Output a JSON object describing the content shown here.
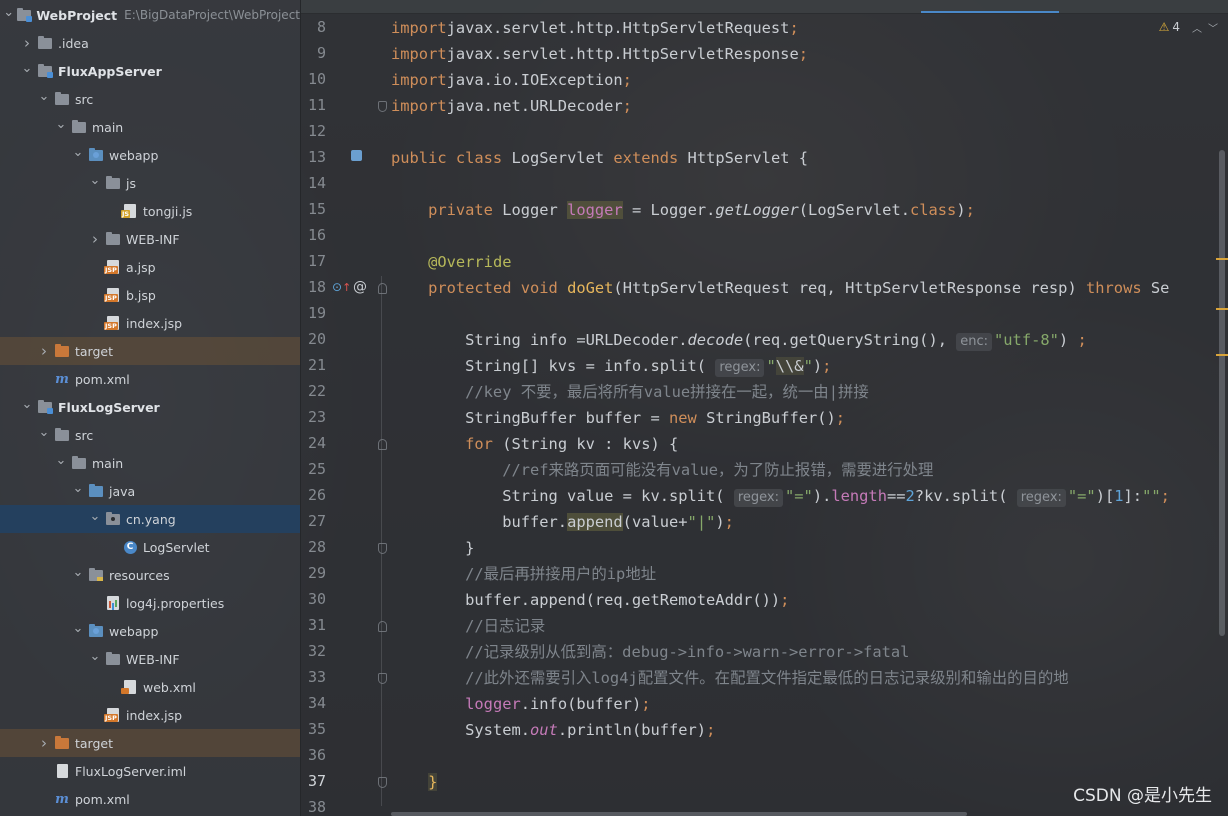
{
  "project_tree": {
    "rows": [
      {
        "label": "WebProject",
        "path": "E:\\BigDataProject\\WebProject",
        "icon": "module-folder-icon",
        "depth": 0,
        "arrow": "down",
        "bold": true
      },
      {
        "label": ".idea",
        "icon": "folder-icon",
        "depth": 1,
        "arrow": "right"
      },
      {
        "label": "FluxAppServer",
        "icon": "module-folder-icon",
        "depth": 1,
        "arrow": "down",
        "bold": true
      },
      {
        "label": "src",
        "icon": "folder-icon",
        "depth": 2,
        "arrow": "down"
      },
      {
        "label": "main",
        "icon": "folder-icon",
        "depth": 3,
        "arrow": "down"
      },
      {
        "label": "webapp",
        "icon": "web-folder-icon",
        "depth": 4,
        "arrow": "down"
      },
      {
        "label": "js",
        "icon": "folder-icon",
        "depth": 5,
        "arrow": "down"
      },
      {
        "label": "tongji.js",
        "icon": "js-file-icon",
        "depth": 6,
        "arrow": "none"
      },
      {
        "label": "WEB-INF",
        "icon": "folder-icon",
        "depth": 5,
        "arrow": "right"
      },
      {
        "label": "a.jsp",
        "icon": "jsp-file-icon",
        "depth": 5,
        "arrow": "none"
      },
      {
        "label": "b.jsp",
        "icon": "jsp-file-icon",
        "depth": 5,
        "arrow": "none"
      },
      {
        "label": "index.jsp",
        "icon": "jsp-file-icon",
        "depth": 5,
        "arrow": "none"
      },
      {
        "label": "target",
        "icon": "excluded-folder-icon",
        "depth": 2,
        "arrow": "right",
        "state": "excluded"
      },
      {
        "label": "pom.xml",
        "icon": "maven-icon",
        "depth": 2,
        "arrow": "none"
      },
      {
        "label": "FluxLogServer",
        "icon": "module-folder-icon",
        "depth": 1,
        "arrow": "down",
        "bold": true
      },
      {
        "label": "src",
        "icon": "folder-icon",
        "depth": 2,
        "arrow": "down"
      },
      {
        "label": "main",
        "icon": "folder-icon",
        "depth": 3,
        "arrow": "down"
      },
      {
        "label": "java",
        "icon": "source-folder-icon",
        "depth": 4,
        "arrow": "down"
      },
      {
        "label": "cn.yang",
        "icon": "package-icon",
        "depth": 5,
        "arrow": "down",
        "state": "selected"
      },
      {
        "label": "LogServlet",
        "icon": "class-icon",
        "depth": 6,
        "arrow": "none"
      },
      {
        "label": "resources",
        "icon": "resources-folder-icon",
        "depth": 4,
        "arrow": "down"
      },
      {
        "label": "log4j.properties",
        "icon": "properties-file-icon",
        "depth": 5,
        "arrow": "none"
      },
      {
        "label": "webapp",
        "icon": "web-folder-icon",
        "depth": 4,
        "arrow": "down"
      },
      {
        "label": "WEB-INF",
        "icon": "folder-icon",
        "depth": 5,
        "arrow": "down"
      },
      {
        "label": "web.xml",
        "icon": "xml-file-icon",
        "depth": 6,
        "arrow": "none"
      },
      {
        "label": "index.jsp",
        "icon": "jsp-file-icon",
        "depth": 5,
        "arrow": "none"
      },
      {
        "label": "target",
        "icon": "excluded-folder-icon",
        "depth": 2,
        "arrow": "right",
        "state": "excluded"
      },
      {
        "label": "FluxLogServer.iml",
        "icon": "iml-file-icon",
        "depth": 2,
        "arrow": "none"
      },
      {
        "label": "pom.xml",
        "icon": "maven-icon",
        "depth": 2,
        "arrow": "none"
      }
    ]
  },
  "editor": {
    "inspection_count": "4",
    "current_line": 37,
    "lines": [
      {
        "n": 8,
        "tokens": [
          [
            "kw",
            "import"
          ],
          [
            "",
            "javax.servlet.http.HttpServletRequest"
          ],
          [
            "kw",
            ";"
          ]
        ]
      },
      {
        "n": 9,
        "tokens": [
          [
            "kw",
            "import"
          ],
          [
            "",
            "javax.servlet.http.HttpServletResponse"
          ],
          [
            "kw",
            ";"
          ]
        ]
      },
      {
        "n": 10,
        "tokens": [
          [
            "kw",
            "import"
          ],
          [
            "",
            "java.io.IOException"
          ],
          [
            "kw",
            ";"
          ]
        ]
      },
      {
        "n": 11,
        "tokens": [
          [
            "kw",
            "import"
          ],
          [
            "",
            "java.net.URLDecoder"
          ],
          [
            "kw",
            ";"
          ]
        ]
      },
      {
        "n": 12,
        "tokens": []
      },
      {
        "n": 13,
        "tokens": [
          [
            "kw",
            "public class "
          ],
          [
            "",
            "LogServlet "
          ],
          [
            "kw",
            "extends "
          ],
          [
            "",
            "HttpServlet {"
          ]
        ]
      },
      {
        "n": 14,
        "tokens": []
      },
      {
        "n": 15,
        "tokens": [
          [
            "",
            "    "
          ],
          [
            "kw",
            "private "
          ],
          [
            "",
            "Logger "
          ],
          [
            "field hl",
            "logger"
          ],
          [
            "",
            " = Logger."
          ],
          [
            "it",
            "getLogger"
          ],
          [
            "",
            "(LogServlet."
          ],
          [
            "kw",
            "class"
          ],
          [
            "",
            ")"
          ],
          [
            "kw",
            ";"
          ]
        ]
      },
      {
        "n": 16,
        "tokens": []
      },
      {
        "n": 17,
        "tokens": [
          [
            "",
            "    "
          ],
          [
            "ann",
            "@Override"
          ]
        ]
      },
      {
        "n": 18,
        "tokens": [
          [
            "",
            "    "
          ],
          [
            "kw",
            "protected void "
          ],
          [
            "fn",
            "doGet"
          ],
          [
            "",
            "(HttpServletRequest req, HttpServletResponse resp) "
          ],
          [
            "kw",
            "throws "
          ],
          [
            "",
            "Se"
          ]
        ]
      },
      {
        "n": 19,
        "tokens": []
      },
      {
        "n": 20,
        "tokens": [
          [
            "",
            "        String info =URLDecoder."
          ],
          [
            "it",
            "decode"
          ],
          [
            "",
            "(req.getQueryString(), "
          ],
          [
            "hint",
            "enc:"
          ],
          [
            "str",
            "\"utf-8\""
          ],
          [
            "",
            ") "
          ],
          [
            "kw",
            ";"
          ]
        ]
      },
      {
        "n": 21,
        "tokens": [
          [
            "",
            "        String[] kvs = info.split( "
          ],
          [
            "hint",
            "regex:"
          ],
          [
            "str",
            "\""
          ],
          [
            "hl2",
            "\\\\&"
          ],
          [
            "str",
            "\""
          ],
          [
            "",
            ")"
          ],
          [
            "kw",
            ";"
          ]
        ]
      },
      {
        "n": 22,
        "tokens": [
          [
            "cmt",
            "        //key 不要，最后将所有value拼接在一起，统一由|拼接"
          ]
        ]
      },
      {
        "n": 23,
        "tokens": [
          [
            "",
            "        StringBuffer buffer = "
          ],
          [
            "kw",
            "new "
          ],
          [
            "",
            "StringBuffer()"
          ],
          [
            "kw",
            ";"
          ]
        ]
      },
      {
        "n": 24,
        "tokens": [
          [
            "",
            "        "
          ],
          [
            "kw",
            "for "
          ],
          [
            "",
            "(String kv : kvs) {"
          ]
        ]
      },
      {
        "n": 25,
        "tokens": [
          [
            "cmt",
            "            //ref来路页面可能没有value，为了防止报错，需要进行处理"
          ]
        ]
      },
      {
        "n": 26,
        "tokens": [
          [
            "",
            "            String value = kv.split( "
          ],
          [
            "hint",
            "regex:"
          ],
          [
            "str",
            "\"=\""
          ],
          [
            "",
            ")."
          ],
          [
            "field",
            "length"
          ],
          [
            "",
            "=="
          ],
          [
            "num",
            "2"
          ],
          [
            "",
            "?kv.split( "
          ],
          [
            "hint",
            "regex:"
          ],
          [
            "str",
            "\"=\""
          ],
          [
            "",
            ")["
          ],
          [
            "num",
            "1"
          ],
          [
            "",
            "]:"
          ],
          [
            "str",
            "\"\""
          ],
          [
            "kw",
            ";"
          ]
        ]
      },
      {
        "n": 27,
        "tokens": [
          [
            "",
            "            buffer."
          ],
          [
            "hl",
            "append"
          ],
          [
            "",
            "(value+"
          ],
          [
            "str",
            "\"|\""
          ],
          [
            "",
            ")"
          ],
          [
            "kw",
            ";"
          ]
        ]
      },
      {
        "n": 28,
        "tokens": [
          [
            "",
            "        }"
          ]
        ]
      },
      {
        "n": 29,
        "tokens": [
          [
            "cmt",
            "        //最后再拼接用户的ip地址"
          ]
        ]
      },
      {
        "n": 30,
        "tokens": [
          [
            "",
            "        buffer.append(req.getRemoteAddr())"
          ],
          [
            "kw",
            ";"
          ]
        ]
      },
      {
        "n": 31,
        "tokens": [
          [
            "cmt",
            "        //日志记录"
          ]
        ]
      },
      {
        "n": 32,
        "tokens": [
          [
            "cmt",
            "        //记录级别从低到高：debug->info->warn->error->fatal"
          ]
        ]
      },
      {
        "n": 33,
        "tokens": [
          [
            "cmt",
            "        //此外还需要引入log4j配置文件。在配置文件指定最低的日志记录级别和输出的目的地"
          ]
        ]
      },
      {
        "n": 34,
        "tokens": [
          [
            "",
            "        "
          ],
          [
            "field",
            "logger"
          ],
          [
            "",
            ".info(buffer)"
          ],
          [
            "kw",
            ";"
          ]
        ]
      },
      {
        "n": 35,
        "tokens": [
          [
            "",
            "        System."
          ],
          [
            "field it",
            "out"
          ],
          [
            "",
            ".println(buffer)"
          ],
          [
            "kw",
            ";"
          ]
        ]
      },
      {
        "n": 36,
        "tokens": []
      },
      {
        "n": 37,
        "tokens": [
          [
            "",
            "    "
          ],
          [
            "fn hl2",
            "}"
          ]
        ]
      },
      {
        "n": 38,
        "tokens": []
      }
    ]
  },
  "watermark": "CSDN @是小先生",
  "colors": {
    "keyword": "#cf8e5a",
    "string": "#86a86a",
    "comment": "#7f858c",
    "annotation": "#b6b85a",
    "field": "#c57ab8",
    "method_decl": "#e6b65c",
    "selection": "#214264"
  }
}
